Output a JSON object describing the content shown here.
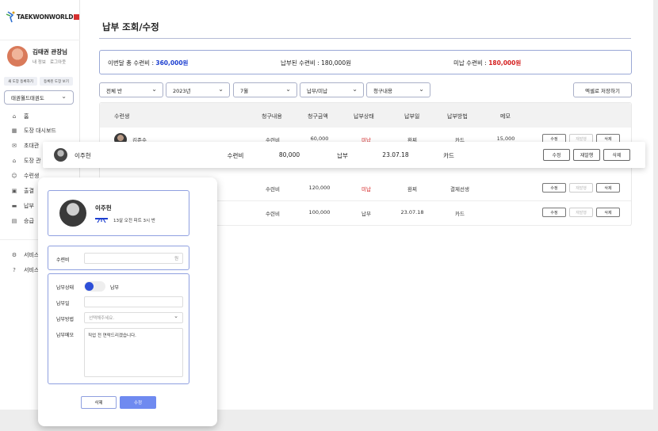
{
  "sidebar": {
    "logo_text": "TAEKWONWORLD",
    "user_name": "김태권 관장님",
    "user_links": [
      "내 정보",
      "로그아웃"
    ],
    "btn_register": "새 도장 등록하기",
    "btn_view": "등록된 도장 보기",
    "dojo_select": "태권월드태권도",
    "nav": [
      {
        "label": "홈",
        "icon": "home-icon"
      },
      {
        "label": "도장 대시보드",
        "icon": "dashboard-icon"
      },
      {
        "label": "초대관",
        "icon": "invite-icon"
      },
      {
        "label": "도장 관",
        "icon": "dojo-icon"
      },
      {
        "label": "수련생",
        "icon": "students-icon"
      },
      {
        "label": "출결",
        "icon": "calendar-icon"
      },
      {
        "label": "납부",
        "icon": "card-icon"
      },
      {
        "label": "승급",
        "icon": "rank-icon"
      }
    ],
    "service": [
      {
        "label": "서비스",
        "icon": "settings-icon"
      },
      {
        "label": "서비스",
        "icon": "help-icon"
      }
    ]
  },
  "main": {
    "title": "납부 조회/수정",
    "summary": {
      "total_label": "이번달 총 수련비 : ",
      "total_value": "360,000원",
      "paid_label": "납부된 수련비 : 180,000원",
      "unpaid_label": "미납 수련비 : ",
      "unpaid_value": "180,000원"
    },
    "filters": [
      "전체 반",
      "2023년",
      "7월",
      "납부/미납",
      "청구내용"
    ],
    "excel_button": "엑셀로 저장하기",
    "table": {
      "headers": [
        "수련생",
        "청구내용",
        "청구금액",
        "납부상태",
        "납부일",
        "납부방법",
        "메모"
      ],
      "rows": [
        {
          "name": "김준수",
          "item": "수련비",
          "amount": "60,000",
          "status": "미납",
          "date": "환찌",
          "method": "카드",
          "memo": "15,000"
        },
        {
          "name": "",
          "item": "수련비",
          "amount": "120,000",
          "status": "미납",
          "date": "환찌",
          "method": "결제선생",
          "memo": ""
        },
        {
          "name": "",
          "item": "수련비",
          "amount": "100,000",
          "status": "납부",
          "date": "23.07.18",
          "method": "카드",
          "memo": ""
        }
      ],
      "btn_edit": "수정",
      "btn_reissue": "재발행",
      "btn_delete": "삭제"
    },
    "highlight_row": {
      "name": "이주헌",
      "item": "수련비",
      "amount": "80,000",
      "status": "납부",
      "date": "23.07.18",
      "method": "카드",
      "btn_edit": "수정",
      "btn_reissue": "재발행",
      "btn_delete": "삭제"
    }
  },
  "panel": {
    "name": "이주헌",
    "info": "13살   오전 피트 3시 반",
    "fee_label": "수련비",
    "fee_unit": "원",
    "status_label": "납부상태",
    "status_value": "납부",
    "date_label": "납부일",
    "method_label": "납부방법",
    "method_placeholder": "선택해주세요.",
    "memo_label": "납부메모",
    "memo_value": "직업 전 연락드리겠습니다.",
    "btn_delete": "삭제",
    "btn_save": "수정"
  },
  "colors": {
    "accent": "#2d4fd8",
    "blue_text": "#1d3fd0",
    "red_text": "#d42020",
    "save_button": "#6f8af0"
  }
}
